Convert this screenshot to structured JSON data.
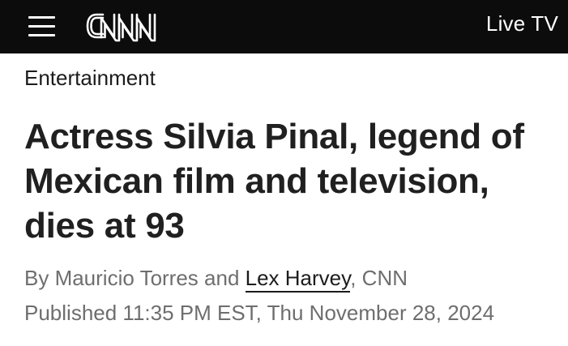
{
  "header": {
    "logo_text": "CNN",
    "live_tv_label": "Live TV"
  },
  "article": {
    "section": "Entertainment",
    "headline": "Actress Silvia Pinal, legend of Mexican film and television, dies at 93",
    "byline": {
      "prefix": "By Mauricio Torres and ",
      "linked_author": "Lex Harvey",
      "suffix": ", CNN"
    },
    "published": "Published 11:35 PM EST, Thu November 28, 2024"
  },
  "colors": {
    "header_bg": "#0c0c0c",
    "headline": "#202020",
    "meta_text": "#6e6e6e"
  }
}
